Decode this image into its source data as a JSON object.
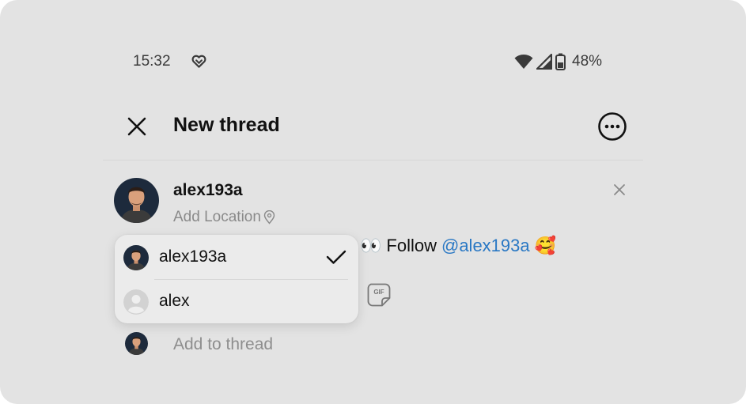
{
  "status_bar": {
    "time": "15:32",
    "battery_percent": "48%",
    "icons": [
      "heart-hands-icon",
      "wifi-icon",
      "signal-icon",
      "battery-icon"
    ]
  },
  "header": {
    "title": "New thread",
    "close_icon": "close-icon",
    "more_icon": "more-options-icon"
  },
  "composer": {
    "username": "alex193a",
    "add_location_label": "Add Location",
    "post_text": {
      "leading_emoji": "👀",
      "prefix": "Follow",
      "mention": "@alex193a",
      "trailing_emoji": "🥰"
    },
    "attachment_icon": "gif-sticker-icon"
  },
  "mention_suggestions": [
    {
      "name": "alex193a",
      "selected": true,
      "avatar": "profile-photo"
    },
    {
      "name": "alex",
      "selected": false,
      "avatar": "default-avatar"
    }
  ],
  "add_to_thread_label": "Add to thread",
  "colors": {
    "background": "#e3e3e3",
    "mention": "#2a78c4",
    "muted_text": "#8a8a8a",
    "dropdown_bg": "#ebebeb"
  }
}
